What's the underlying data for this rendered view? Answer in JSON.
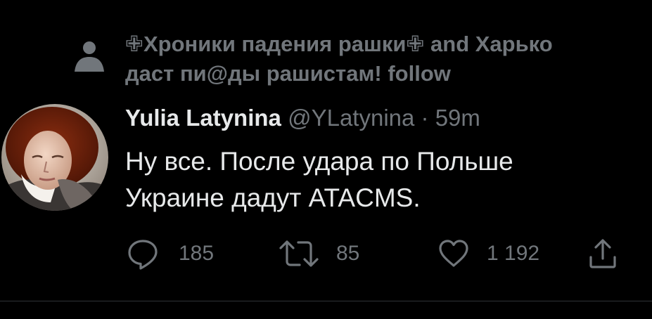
{
  "social_context": {
    "icon": "person-icon",
    "line1": "✙Хроники падения рашки✙ and Харько",
    "line2": "даст пи@ды рашистам! follow"
  },
  "tweet": {
    "author_name": "Yulia Latynina",
    "handle": "@YLatynina",
    "separator": "·",
    "time": "59m",
    "text_line1": "Ну все. После удара по Польше",
    "text_line2": "Украине дадут ATACMS."
  },
  "actions": {
    "reply": {
      "icon": "reply-icon",
      "count": "185"
    },
    "retweet": {
      "icon": "retweet-icon",
      "count": "85"
    },
    "like": {
      "icon": "heart-icon",
      "count": "1 192"
    },
    "share": {
      "icon": "share-icon"
    }
  },
  "colors": {
    "background": "#000000",
    "primary_text": "#e7e9ea",
    "secondary_text": "#71767b"
  }
}
